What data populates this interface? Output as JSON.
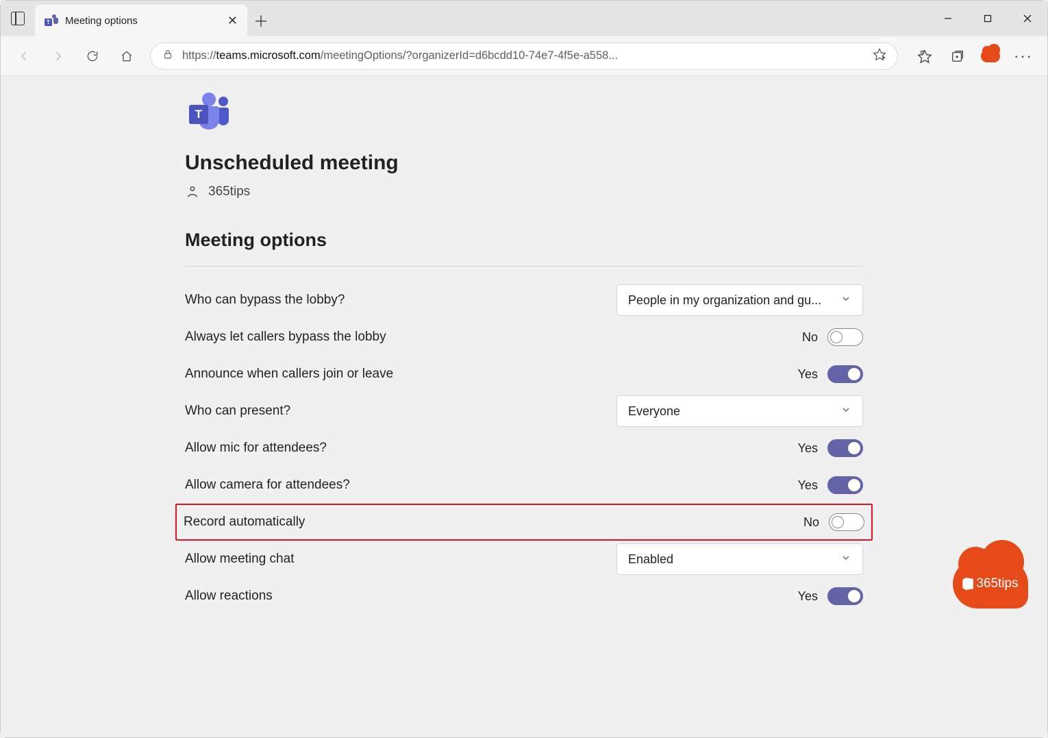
{
  "browser": {
    "tab_title": "Meeting options",
    "url_protocol": "https://",
    "url_host": "teams.microsoft.com",
    "url_path": "/meetingOptions/?organizerId=d6bcdd10-74e7-4f5e-a558..."
  },
  "page": {
    "title": "Unscheduled meeting",
    "organizer": "365tips",
    "section_heading": "Meeting options",
    "options": {
      "bypass_lobby": {
        "label": "Who can bypass the lobby?",
        "value": "People in my organization and gu..."
      },
      "callers_bypass": {
        "label": "Always let callers bypass the lobby",
        "value": "No",
        "on": false
      },
      "announce": {
        "label": "Announce when callers join or leave",
        "value": "Yes",
        "on": true
      },
      "present": {
        "label": "Who can present?",
        "value": "Everyone"
      },
      "allow_mic": {
        "label": "Allow mic for attendees?",
        "value": "Yes",
        "on": true
      },
      "allow_cam": {
        "label": "Allow camera for attendees?",
        "value": "Yes",
        "on": true
      },
      "record_auto": {
        "label": "Record automatically",
        "value": "No",
        "on": false
      },
      "meeting_chat": {
        "label": "Allow meeting chat",
        "value": "Enabled"
      },
      "reactions": {
        "label": "Allow reactions",
        "value": "Yes",
        "on": true
      }
    }
  },
  "badge": {
    "text": "365tips"
  }
}
